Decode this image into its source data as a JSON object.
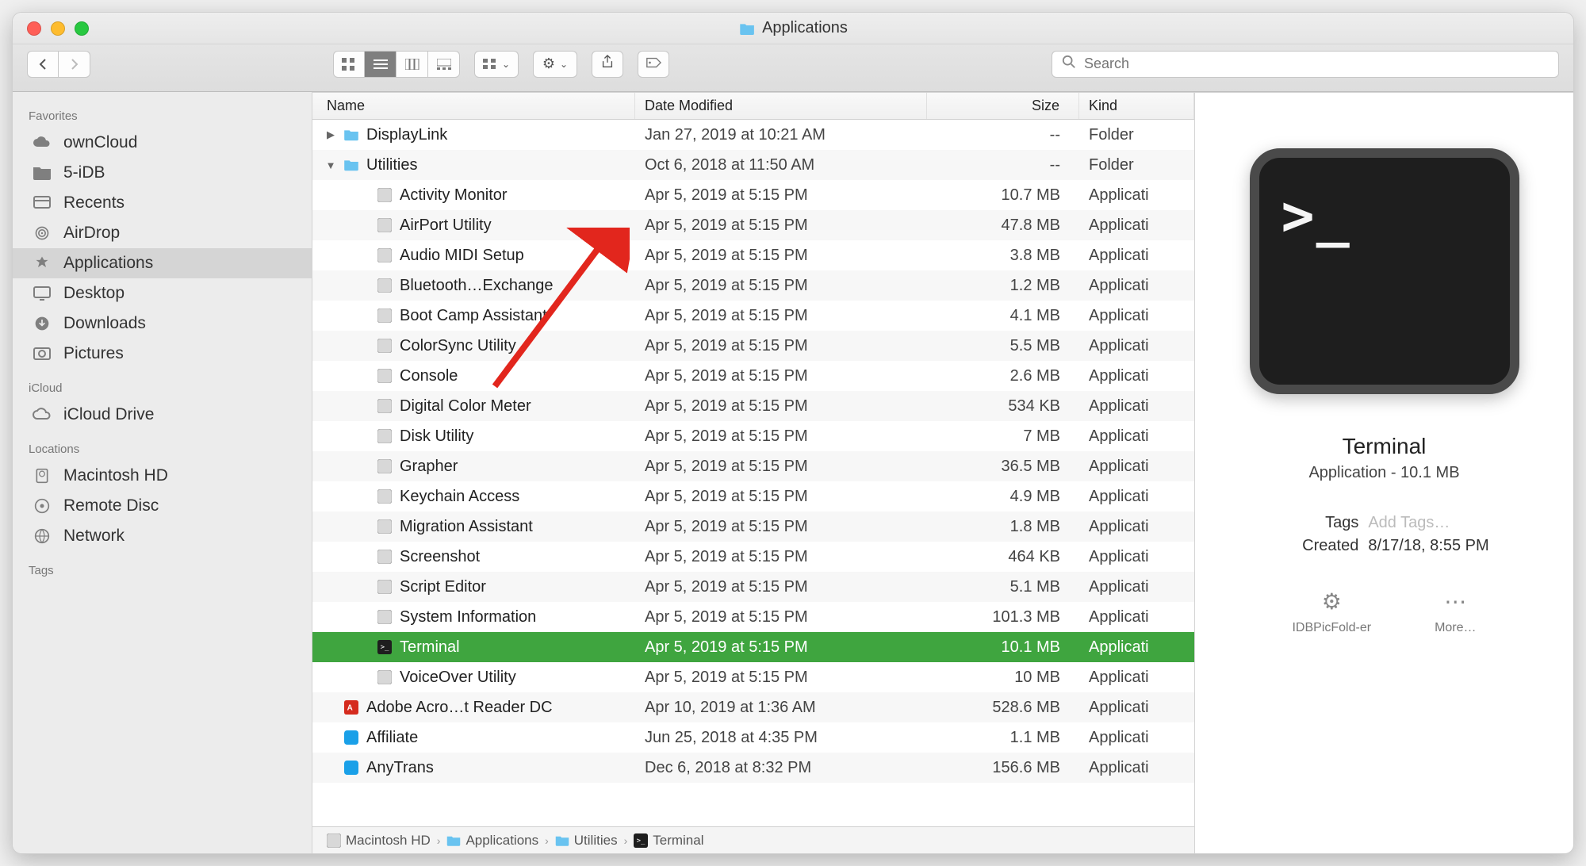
{
  "window_title": "Applications",
  "search_placeholder": "Search",
  "toolbar": {
    "share_icon": "share",
    "tags_icon": "tag"
  },
  "sidebar": {
    "sections": [
      {
        "label": "Favorites",
        "items": [
          {
            "label": "ownCloud",
            "icon": "cloud"
          },
          {
            "label": "5-iDB",
            "icon": "folder"
          },
          {
            "label": "Recents",
            "icon": "recents"
          },
          {
            "label": "AirDrop",
            "icon": "airdrop"
          },
          {
            "label": "Applications",
            "icon": "app",
            "selected": true
          },
          {
            "label": "Desktop",
            "icon": "desktop"
          },
          {
            "label": "Downloads",
            "icon": "downloads"
          },
          {
            "label": "Pictures",
            "icon": "pictures"
          }
        ]
      },
      {
        "label": "iCloud",
        "items": [
          {
            "label": "iCloud Drive",
            "icon": "icloud"
          }
        ]
      },
      {
        "label": "Locations",
        "items": [
          {
            "label": "Macintosh HD",
            "icon": "disk"
          },
          {
            "label": "Remote Disc",
            "icon": "remote"
          },
          {
            "label": "Network",
            "icon": "network"
          }
        ]
      },
      {
        "label": "Tags",
        "items": []
      }
    ]
  },
  "columns": {
    "name": "Name",
    "date": "Date Modified",
    "size": "Size",
    "kind": "Kind"
  },
  "rows": [
    {
      "indent": 0,
      "disclosure": "closed",
      "icon": "folder",
      "name": "DisplayLink",
      "date": "Jan 27, 2019 at 10:21 AM",
      "size": "--",
      "kind": "Folder"
    },
    {
      "indent": 0,
      "disclosure": "open",
      "icon": "folder",
      "name": "Utilities",
      "date": "Oct 6, 2018 at 11:50 AM",
      "size": "--",
      "kind": "Folder"
    },
    {
      "indent": 1,
      "icon": "app",
      "name": "Activity Monitor",
      "date": "Apr 5, 2019 at 5:15 PM",
      "size": "10.7 MB",
      "kind": "Applicati"
    },
    {
      "indent": 1,
      "icon": "app",
      "name": "AirPort Utility",
      "date": "Apr 5, 2019 at 5:15 PM",
      "size": "47.8 MB",
      "kind": "Applicati"
    },
    {
      "indent": 1,
      "icon": "app",
      "name": "Audio MIDI Setup",
      "date": "Apr 5, 2019 at 5:15 PM",
      "size": "3.8 MB",
      "kind": "Applicati"
    },
    {
      "indent": 1,
      "icon": "app",
      "name": "Bluetooth…Exchange",
      "date": "Apr 5, 2019 at 5:15 PM",
      "size": "1.2 MB",
      "kind": "Applicati"
    },
    {
      "indent": 1,
      "icon": "app",
      "name": "Boot Camp Assistant",
      "date": "Apr 5, 2019 at 5:15 PM",
      "size": "4.1 MB",
      "kind": "Applicati"
    },
    {
      "indent": 1,
      "icon": "app",
      "name": "ColorSync Utility",
      "date": "Apr 5, 2019 at 5:15 PM",
      "size": "5.5 MB",
      "kind": "Applicati"
    },
    {
      "indent": 1,
      "icon": "app",
      "name": "Console",
      "date": "Apr 5, 2019 at 5:15 PM",
      "size": "2.6 MB",
      "kind": "Applicati"
    },
    {
      "indent": 1,
      "icon": "app",
      "name": "Digital Color Meter",
      "date": "Apr 5, 2019 at 5:15 PM",
      "size": "534 KB",
      "kind": "Applicati"
    },
    {
      "indent": 1,
      "icon": "app",
      "name": "Disk Utility",
      "date": "Apr 5, 2019 at 5:15 PM",
      "size": "7 MB",
      "kind": "Applicati"
    },
    {
      "indent": 1,
      "icon": "app",
      "name": "Grapher",
      "date": "Apr 5, 2019 at 5:15 PM",
      "size": "36.5 MB",
      "kind": "Applicati"
    },
    {
      "indent": 1,
      "icon": "app",
      "name": "Keychain Access",
      "date": "Apr 5, 2019 at 5:15 PM",
      "size": "4.9 MB",
      "kind": "Applicati"
    },
    {
      "indent": 1,
      "icon": "app",
      "name": "Migration Assistant",
      "date": "Apr 5, 2019 at 5:15 PM",
      "size": "1.8 MB",
      "kind": "Applicati"
    },
    {
      "indent": 1,
      "icon": "app",
      "name": "Screenshot",
      "date": "Apr 5, 2019 at 5:15 PM",
      "size": "464 KB",
      "kind": "Applicati"
    },
    {
      "indent": 1,
      "icon": "app",
      "name": "Script Editor",
      "date": "Apr 5, 2019 at 5:15 PM",
      "size": "5.1 MB",
      "kind": "Applicati"
    },
    {
      "indent": 1,
      "icon": "app",
      "name": "System Information",
      "date": "Apr 5, 2019 at 5:15 PM",
      "size": "101.3 MB",
      "kind": "Applicati"
    },
    {
      "indent": 1,
      "icon": "terminal",
      "name": "Terminal",
      "date": "Apr 5, 2019 at 5:15 PM",
      "size": "10.1 MB",
      "kind": "Applicati",
      "selected": true
    },
    {
      "indent": 1,
      "icon": "app",
      "name": "VoiceOver Utility",
      "date": "Apr 5, 2019 at 5:15 PM",
      "size": "10 MB",
      "kind": "Applicati"
    },
    {
      "indent": 0,
      "icon": "pdf",
      "name": "Adobe Acro…t Reader DC",
      "date": "Apr 10, 2019 at 1:36 AM",
      "size": "528.6 MB",
      "kind": "Applicati"
    },
    {
      "indent": 0,
      "icon": "app-blue",
      "name": "Affiliate",
      "date": "Jun 25, 2018 at 4:35 PM",
      "size": "1.1 MB",
      "kind": "Applicati"
    },
    {
      "indent": 0,
      "icon": "app-blue",
      "name": "AnyTrans",
      "date": "Dec 6, 2018 at 8:32 PM",
      "size": "156.6 MB",
      "kind": "Applicati"
    }
  ],
  "path": [
    {
      "label": "Macintosh HD",
      "icon": "disk"
    },
    {
      "label": "Applications",
      "icon": "folder"
    },
    {
      "label": "Utilities",
      "icon": "folder"
    },
    {
      "label": "Terminal",
      "icon": "terminal"
    }
  ],
  "preview": {
    "name": "Terminal",
    "subtitle": "Application - 10.1 MB",
    "tags_label": "Tags",
    "tags_placeholder": "Add Tags…",
    "created_label": "Created",
    "created_value": "8/17/18, 8:55 PM",
    "action1": "IDBPicFold-er",
    "action2": "More…"
  }
}
